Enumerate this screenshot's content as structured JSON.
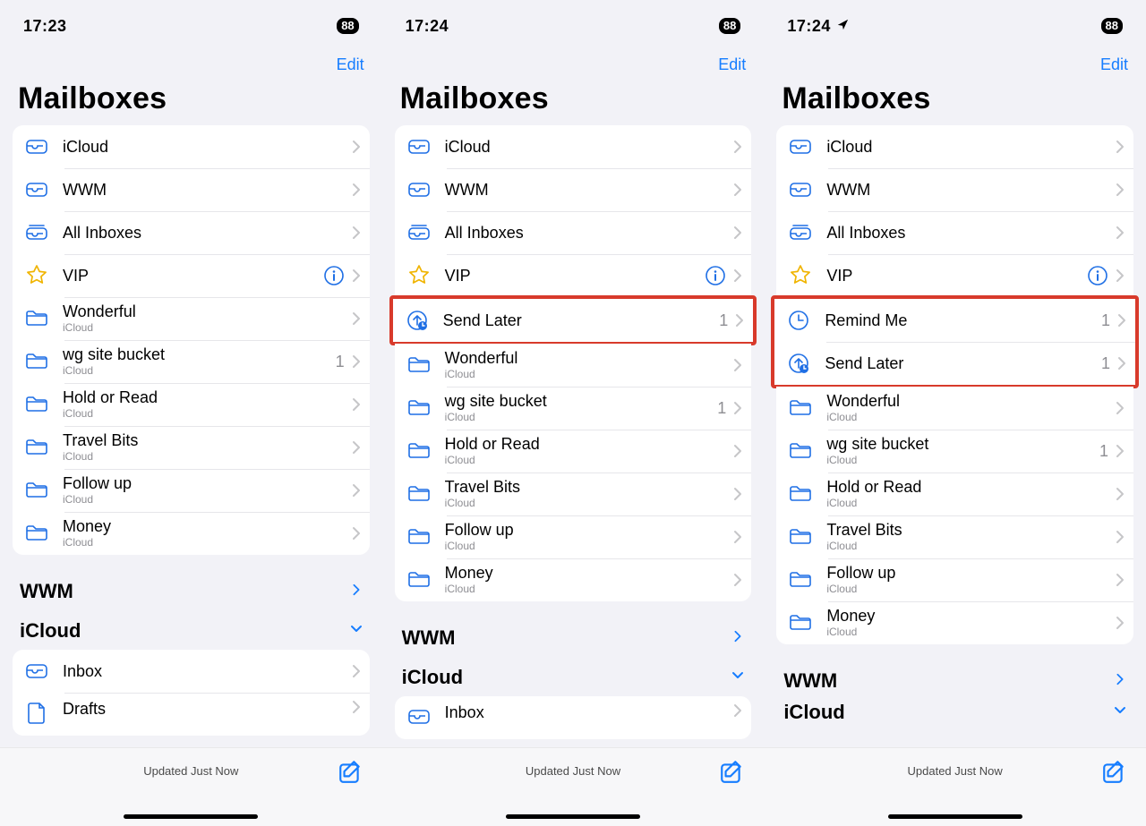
{
  "screens": [
    {
      "time": "17:23",
      "battery": "88",
      "showLocation": false,
      "edit": "Edit",
      "title": "Mailboxes",
      "updated": "Updated Just Now",
      "groups": [
        {
          "highlight": false,
          "rows": [
            {
              "icon": "inbox",
              "label": "iCloud"
            },
            {
              "icon": "inbox",
              "label": "WWM"
            },
            {
              "icon": "allinbox",
              "label": "All Inboxes"
            },
            {
              "icon": "star",
              "label": "VIP",
              "info": true
            },
            {
              "icon": "folder",
              "label": "Wonderful",
              "sub": "iCloud"
            },
            {
              "icon": "folder",
              "label": "wg site bucket",
              "sub": "iCloud",
              "count": "1"
            },
            {
              "icon": "folder",
              "label": " Hold or Read",
              "sub": "iCloud"
            },
            {
              "icon": "folder",
              "label": " Travel Bits",
              "sub": "iCloud"
            },
            {
              "icon": "folder",
              "label": "Follow up",
              "sub": "iCloud"
            },
            {
              "icon": "folder",
              "label": "Money",
              "sub": "iCloud"
            }
          ]
        }
      ],
      "sections": [
        {
          "label": "WWM",
          "expanded": false
        },
        {
          "label": "iCloud",
          "expanded": true
        }
      ],
      "extraCard": {
        "rows": [
          {
            "icon": "inbox",
            "label": "Inbox"
          },
          {
            "icon": "draft",
            "label": "Drafts",
            "cut": true
          }
        ]
      }
    },
    {
      "time": "17:24",
      "battery": "88",
      "showLocation": false,
      "edit": "Edit",
      "title": "Mailboxes",
      "updated": "Updated Just Now",
      "groups": [
        {
          "highlight": false,
          "rows": [
            {
              "icon": "inbox",
              "label": "iCloud"
            },
            {
              "icon": "inbox",
              "label": "WWM"
            },
            {
              "icon": "allinbox",
              "label": "All Inboxes"
            },
            {
              "icon": "star",
              "label": "VIP",
              "info": true
            }
          ]
        },
        {
          "highlight": true,
          "rows": [
            {
              "icon": "sendlater",
              "label": "Send Later",
              "count": "1"
            }
          ]
        },
        {
          "highlight": false,
          "rows": [
            {
              "icon": "folder",
              "label": "Wonderful",
              "sub": "iCloud"
            },
            {
              "icon": "folder",
              "label": "wg site bucket",
              "sub": "iCloud",
              "count": "1"
            },
            {
              "icon": "folder",
              "label": " Hold or Read",
              "sub": "iCloud"
            },
            {
              "icon": "folder",
              "label": " Travel Bits",
              "sub": "iCloud"
            },
            {
              "icon": "folder",
              "label": "Follow up",
              "sub": "iCloud"
            },
            {
              "icon": "folder",
              "label": "Money",
              "sub": "iCloud"
            }
          ]
        }
      ],
      "sections": [
        {
          "label": "WWM",
          "expanded": false
        },
        {
          "label": "iCloud",
          "expanded": true
        }
      ],
      "extraCard": {
        "rows": [
          {
            "icon": "inbox",
            "label": "Inbox",
            "cut": true
          }
        ]
      }
    },
    {
      "time": "17:24",
      "battery": "88",
      "showLocation": true,
      "edit": "Edit",
      "title": "Mailboxes",
      "updated": "Updated Just Now",
      "groups": [
        {
          "highlight": false,
          "rows": [
            {
              "icon": "inbox",
              "label": "iCloud"
            },
            {
              "icon": "inbox",
              "label": "WWM"
            },
            {
              "icon": "allinbox",
              "label": "All Inboxes"
            },
            {
              "icon": "star",
              "label": "VIP",
              "info": true
            }
          ]
        },
        {
          "highlight": true,
          "rows": [
            {
              "icon": "clock",
              "label": "Remind Me",
              "count": "1"
            },
            {
              "icon": "sendlater",
              "label": "Send Later",
              "count": "1"
            }
          ]
        },
        {
          "highlight": false,
          "rows": [
            {
              "icon": "folder",
              "label": "Wonderful",
              "sub": "iCloud"
            },
            {
              "icon": "folder",
              "label": "wg site bucket",
              "sub": "iCloud",
              "count": "1"
            },
            {
              "icon": "folder",
              "label": " Hold or Read",
              "sub": "iCloud"
            },
            {
              "icon": "folder",
              "label": " Travel Bits",
              "sub": "iCloud"
            },
            {
              "icon": "folder",
              "label": "Follow up",
              "sub": "iCloud"
            },
            {
              "icon": "folder",
              "label": "Money",
              "sub": "iCloud"
            }
          ]
        }
      ],
      "sections": [
        {
          "label": "WWM",
          "expanded": false
        },
        {
          "label": "iCloud",
          "expanded": true,
          "cut": true
        }
      ]
    }
  ]
}
